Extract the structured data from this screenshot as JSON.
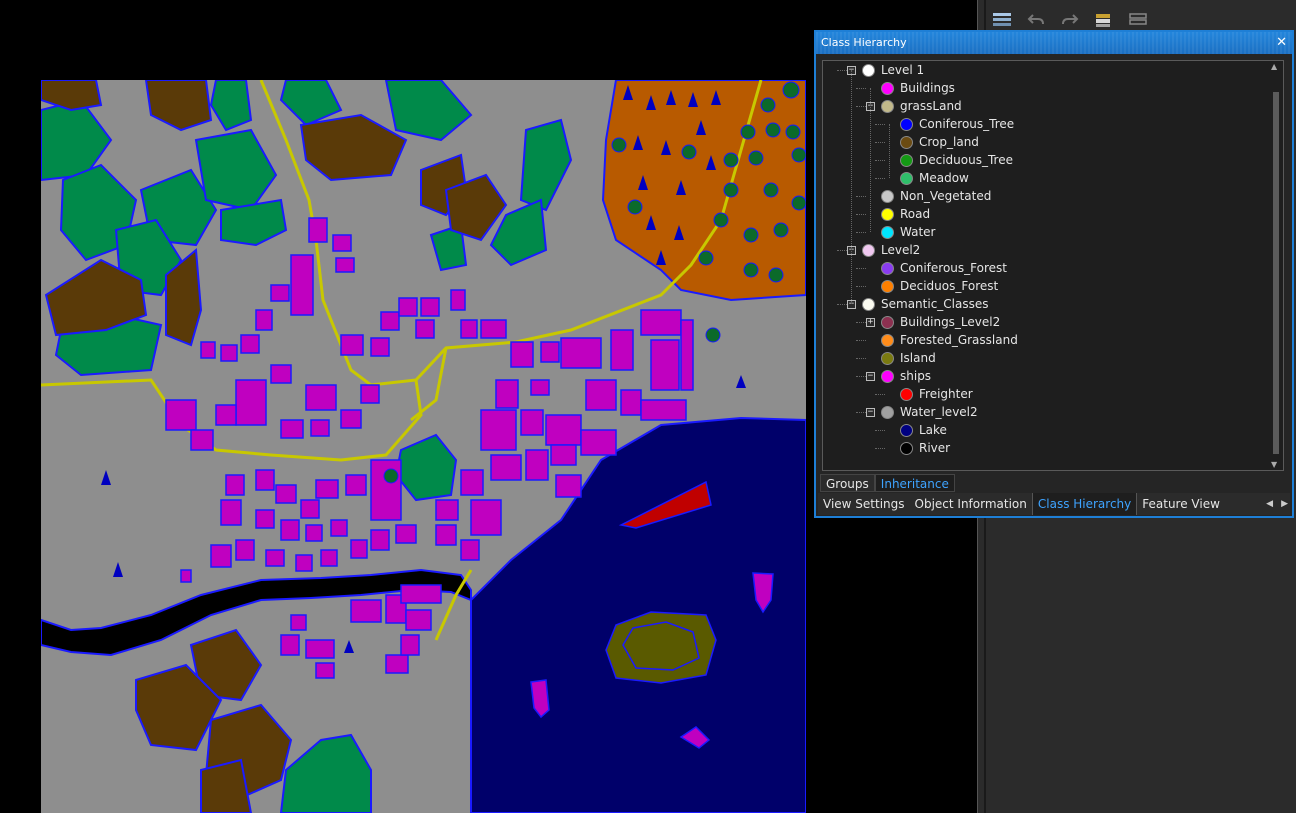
{
  "panel": {
    "title": "Class Hierarchy",
    "close_label": "✕",
    "tree": [
      {
        "label": "Level 1",
        "depth": 0,
        "toggle": "−",
        "color": "#ffffff"
      },
      {
        "label": "Buildings",
        "depth": 1,
        "toggle": "",
        "color": "#ff00ff"
      },
      {
        "label": "grassLand",
        "depth": 1,
        "toggle": "−",
        "color": "#c2b98a"
      },
      {
        "label": "Coniferous_Tree",
        "depth": 2,
        "toggle": "",
        "color": "#0000ff"
      },
      {
        "label": "Crop_land",
        "depth": 2,
        "toggle": "",
        "color": "#6b4b12"
      },
      {
        "label": "Deciduous_Tree",
        "depth": 2,
        "toggle": "",
        "color": "#149a14"
      },
      {
        "label": "Meadow",
        "depth": 2,
        "toggle": "",
        "color": "#2fbf6a"
      },
      {
        "label": "Non_Vegetated",
        "depth": 1,
        "toggle": "",
        "color": "#c8c8c8"
      },
      {
        "label": "Road",
        "depth": 1,
        "toggle": "",
        "color": "#ffff00"
      },
      {
        "label": "Water",
        "depth": 1,
        "toggle": "",
        "color": "#00e5ff"
      },
      {
        "label": "Level2",
        "depth": 0,
        "toggle": "−",
        "color": "#f0c8f0"
      },
      {
        "label": "Coniferous_Forest",
        "depth": 1,
        "toggle": "",
        "color": "#8a3cf0"
      },
      {
        "label": "Deciduos_Forest",
        "depth": 1,
        "toggle": "",
        "color": "#ff8000"
      },
      {
        "label": "Semantic_Classes",
        "depth": 0,
        "toggle": "−",
        "color": "#fafaf0"
      },
      {
        "label": "Buildings_Level2",
        "depth": 1,
        "toggle": "+",
        "color": "#8c3050"
      },
      {
        "label": "Forested_Grassland",
        "depth": 1,
        "toggle": "",
        "color": "#ff8c1a"
      },
      {
        "label": "Island",
        "depth": 1,
        "toggle": "",
        "color": "#7a7a10"
      },
      {
        "label": "ships",
        "depth": 1,
        "toggle": "−",
        "color": "#ff00ff"
      },
      {
        "label": "Freighter",
        "depth": 2,
        "toggle": "",
        "color": "#ff0000"
      },
      {
        "label": "Water_level2",
        "depth": 1,
        "toggle": "−",
        "color": "#a0a0a0"
      },
      {
        "label": "Lake",
        "depth": 2,
        "toggle": "",
        "color": "#000080"
      },
      {
        "label": "River",
        "depth": 2,
        "toggle": "",
        "color": "#000000"
      }
    ],
    "subtabs": [
      "Groups",
      "Inheritance"
    ],
    "subtab_active": 1,
    "bottomtabs": [
      "View Settings",
      "Object Information",
      "Class Hierarchy",
      "Feature View"
    ],
    "bottomtab_active": 2,
    "nav_prev": "◀",
    "nav_next": "▶"
  },
  "toolbar": {
    "icons": [
      "layers-icon",
      "undo-icon",
      "redo-icon",
      "database-icon",
      "stack-icon"
    ]
  },
  "map": {
    "colors": {
      "background": "#8e8e8e",
      "building": "#c000c0",
      "meadow": "#008a4a",
      "cropland": "#5a3a08",
      "forest": "#b85a00",
      "water": "#00006a",
      "river": "#000000",
      "road": "#c8c800",
      "outline": "#1a1aff",
      "freighter": "#c00000",
      "island": "#5a5a00"
    }
  }
}
